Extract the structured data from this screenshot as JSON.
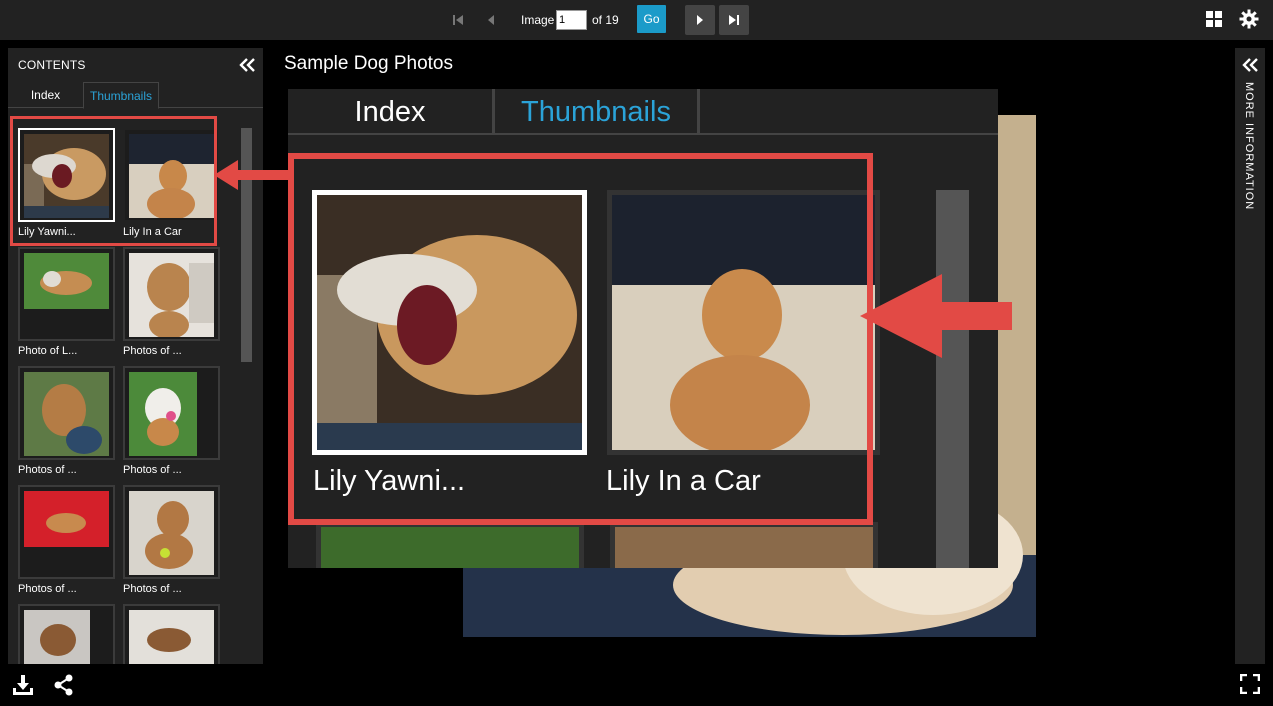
{
  "toolbar": {
    "image_label": "Image",
    "image_value": "1",
    "of_label": "of 19",
    "go_label": "Go"
  },
  "icons": {
    "first": "skip-to-first-icon",
    "prev": "previous-icon",
    "next": "next-icon",
    "last": "skip-to-last-icon",
    "grid": "grid-view-icon",
    "settings": "gear-icon",
    "collapse_left": "double-chevron-left-icon",
    "collapse_right": "double-chevron-left-icon",
    "download": "download-icon",
    "share": "share-icon",
    "fullscreen": "fullscreen-icon"
  },
  "sidebar": {
    "title": "CONTENTS",
    "tabs": [
      {
        "label": "Index",
        "active": false
      },
      {
        "label": "Thumbnails",
        "active": true
      }
    ],
    "thumbnails": [
      {
        "caption": "Lily Yawni...",
        "selected": true
      },
      {
        "caption": "Lily In a Car",
        "selected": false
      },
      {
        "caption": "Photo of L...",
        "selected": false
      },
      {
        "caption": "Photos of ...",
        "selected": false
      },
      {
        "caption": "Photos of ...",
        "selected": false
      },
      {
        "caption": "Photos of ...",
        "selected": false
      },
      {
        "caption": "Photos of ...",
        "selected": false
      },
      {
        "caption": "Photos of ...",
        "selected": false
      },
      {
        "caption": "",
        "selected": false
      },
      {
        "caption": "",
        "selected": false
      }
    ]
  },
  "main": {
    "title": "Sample Dog Photos"
  },
  "zoom_callout": {
    "tab_index": "Index",
    "tab_thumbnails": "Thumbnails",
    "caption_1": "Lily Yawni...",
    "caption_2": "Lily In a Car"
  },
  "right_panel": {
    "label": "MORE INFORMATION"
  },
  "colors": {
    "accent": "#1b9bc9",
    "tab_active": "#2ba3d8",
    "highlight_red": "#e24a45",
    "panel": "#222222",
    "background": "#000000"
  }
}
